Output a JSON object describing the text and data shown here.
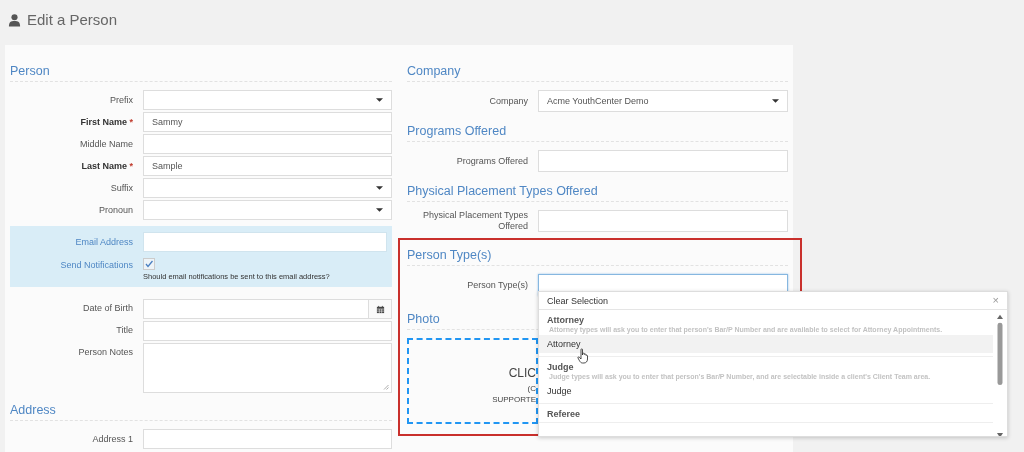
{
  "page_title": "Edit a Person",
  "required_mark": "*",
  "left": {
    "sections": [
      {
        "heading": "Person",
        "fields": [
          {
            "label": "Prefix",
            "kind": "select"
          },
          {
            "label": "First Name",
            "kind": "text",
            "required": true,
            "value": "Sammy"
          },
          {
            "label": "Middle Name",
            "kind": "text"
          },
          {
            "label": "Last Name",
            "kind": "text",
            "required": true,
            "value": "Sample"
          },
          {
            "label": "Suffix",
            "kind": "select"
          },
          {
            "label": "Pronoun",
            "kind": "select"
          }
        ],
        "notification": {
          "email_label": "Email Address",
          "notify_label": "Send Notifications",
          "checked": true,
          "help": "Should email notifications be sent to this email address?"
        },
        "more_fields": [
          {
            "label": "Date of Birth",
            "kind": "date"
          },
          {
            "label": "Title",
            "kind": "text"
          },
          {
            "label": "Person Notes",
            "kind": "textarea"
          }
        ]
      },
      {
        "heading": "Address",
        "fields": [
          {
            "label": "Address 1",
            "kind": "text"
          }
        ]
      }
    ]
  },
  "right": {
    "sections": [
      {
        "heading": "Company",
        "fields": [
          {
            "label": "Company",
            "kind": "select",
            "value": "Acme YouthCenter Demo"
          }
        ]
      },
      {
        "heading": "Programs Offered",
        "fields": [
          {
            "label": "Programs Offered",
            "kind": "text"
          }
        ]
      },
      {
        "heading": "Physical Placement Types Offered",
        "fields": [
          {
            "label": "Physical Placement Types Offered",
            "kind": "text"
          }
        ]
      },
      {
        "heading": "Person Type(s)",
        "fields": [
          {
            "label": "Person Type(s)",
            "kind": "text",
            "focused": true
          }
        ]
      }
    ],
    "photo": {
      "heading": "Photo",
      "lines": [
        "CLIC",
        "(C",
        "SUPPORTE"
      ]
    }
  },
  "dropdown": {
    "clear": "Clear Selection",
    "close": "×",
    "groups": [
      {
        "name": "Attorney",
        "description": "Attorney types will ask you to enter that person's Bar/P Number and are available to select for Attorney Appointments.",
        "options": [
          {
            "label": "Attorney",
            "hovered": true
          }
        ]
      },
      {
        "name": "Judge",
        "description": "Judge types will ask you to enter that person's Bar/P Number, and are selectable inside a client's Client Team area.",
        "options": [
          {
            "label": "Judge",
            "hovered": false
          }
        ]
      },
      {
        "name": "Referee"
      }
    ]
  }
}
